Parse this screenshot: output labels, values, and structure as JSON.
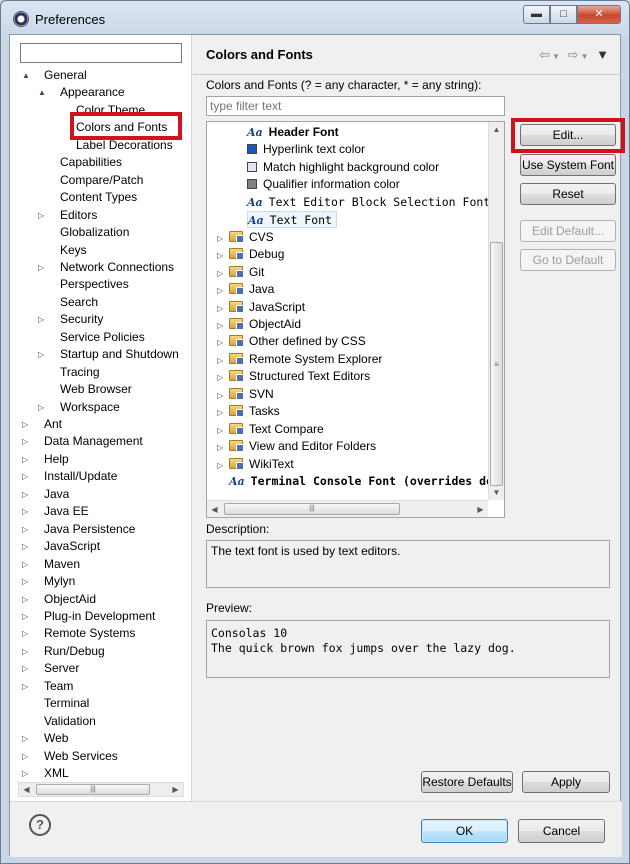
{
  "window": {
    "title": "Preferences"
  },
  "left_tree": {
    "filter_value": "",
    "items": [
      {
        "label": "General",
        "exp": "▲"
      },
      {
        "label": "Appearance",
        "exp": "▲"
      },
      {
        "label": "Color Theme",
        "exp": ""
      },
      {
        "label": "Colors and Fonts",
        "exp": ""
      },
      {
        "label": "Label Decorations",
        "exp": ""
      },
      {
        "label": "Capabilities",
        "exp": ""
      },
      {
        "label": "Compare/Patch",
        "exp": ""
      },
      {
        "label": "Content Types",
        "exp": ""
      },
      {
        "label": "Editors",
        "exp": "▷"
      },
      {
        "label": "Globalization",
        "exp": ""
      },
      {
        "label": "Keys",
        "exp": ""
      },
      {
        "label": "Network Connections",
        "exp": "▷"
      },
      {
        "label": "Perspectives",
        "exp": ""
      },
      {
        "label": "Search",
        "exp": ""
      },
      {
        "label": "Security",
        "exp": "▷"
      },
      {
        "label": "Service Policies",
        "exp": ""
      },
      {
        "label": "Startup and Shutdown",
        "exp": "▷"
      },
      {
        "label": "Tracing",
        "exp": ""
      },
      {
        "label": "Web Browser",
        "exp": ""
      },
      {
        "label": "Workspace",
        "exp": "▷"
      },
      {
        "label": "Ant",
        "exp": "▷"
      },
      {
        "label": "Data Management",
        "exp": "▷"
      },
      {
        "label": "Help",
        "exp": "▷"
      },
      {
        "label": "Install/Update",
        "exp": "▷"
      },
      {
        "label": "Java",
        "exp": "▷"
      },
      {
        "label": "Java EE",
        "exp": "▷"
      },
      {
        "label": "Java Persistence",
        "exp": "▷"
      },
      {
        "label": "JavaScript",
        "exp": "▷"
      },
      {
        "label": "Maven",
        "exp": "▷"
      },
      {
        "label": "Mylyn",
        "exp": "▷"
      },
      {
        "label": "ObjectAid",
        "exp": "▷"
      },
      {
        "label": "Plug-in Development",
        "exp": "▷"
      },
      {
        "label": "Remote Systems",
        "exp": "▷"
      },
      {
        "label": "Run/Debug",
        "exp": "▷"
      },
      {
        "label": "Server",
        "exp": "▷"
      },
      {
        "label": "Team",
        "exp": "▷"
      },
      {
        "label": "Terminal",
        "exp": ""
      },
      {
        "label": "Validation",
        "exp": ""
      },
      {
        "label": "Web",
        "exp": "▷"
      },
      {
        "label": "Web Services",
        "exp": "▷"
      },
      {
        "label": "XML",
        "exp": "▷"
      }
    ]
  },
  "page": {
    "title": "Colors and Fonts",
    "intro": "Colors and Fonts (? = any character, * = any string):",
    "filter_placeholder": "type filter text",
    "tree_items": [
      {
        "kind": "font",
        "label": "Header Font"
      },
      {
        "kind": "color",
        "label": "Hyperlink text color",
        "color": "#1a5cb5"
      },
      {
        "kind": "color",
        "label": "Match highlight background color",
        "color": "#e4e4f2"
      },
      {
        "kind": "color",
        "label": "Qualifier information color",
        "color": "#808080"
      },
      {
        "kind": "font",
        "label": "Text Editor Block Selection Font"
      },
      {
        "kind": "font",
        "label": "Text Font"
      },
      {
        "kind": "folder",
        "label": "CVS"
      },
      {
        "kind": "folder",
        "label": "Debug"
      },
      {
        "kind": "folder",
        "label": "Git"
      },
      {
        "kind": "folder",
        "label": "Java"
      },
      {
        "kind": "folder",
        "label": "JavaScript"
      },
      {
        "kind": "folder",
        "label": "ObjectAid"
      },
      {
        "kind": "folder",
        "label": "Other defined by CSS"
      },
      {
        "kind": "folder",
        "label": "Remote System Explorer"
      },
      {
        "kind": "folder",
        "label": "Structured Text Editors"
      },
      {
        "kind": "folder",
        "label": "SVN"
      },
      {
        "kind": "folder",
        "label": "Tasks"
      },
      {
        "kind": "folder",
        "label": "Text Compare"
      },
      {
        "kind": "folder",
        "label": "View and Editor Folders"
      },
      {
        "kind": "folder",
        "label": "WikiText"
      },
      {
        "kind": "font",
        "label": "Terminal Console Font (overrides de"
      }
    ],
    "buttons": {
      "edit": "Edit...",
      "use_system_font": "Use System Font",
      "reset": "Reset",
      "edit_default": "Edit Default...",
      "go_to_default": "Go to Default"
    },
    "description_label": "Description:",
    "description_text": "The text font is used by text editors.",
    "preview_label": "Preview:",
    "preview_line1": "Consolas 10",
    "preview_line2": "The quick brown fox jumps over the lazy dog.",
    "restore_defaults": "Restore Defaults",
    "apply": "Apply"
  },
  "footer": {
    "ok": "OK",
    "cancel": "Cancel",
    "help_glyph": "?"
  },
  "icons": {
    "font_glyph": "Aa",
    "scroll_grip": "≡"
  },
  "colors": {
    "highlight_box": "#d0121b",
    "selection": "#cce8ff"
  }
}
